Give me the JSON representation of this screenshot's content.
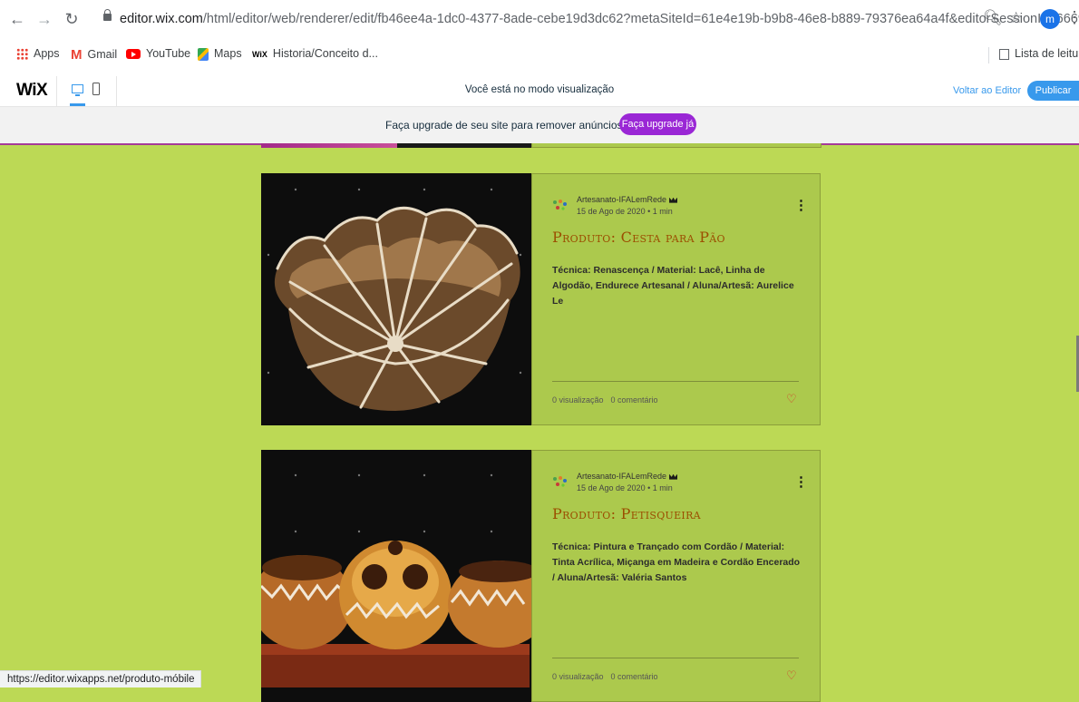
{
  "browser": {
    "url_host": "editor.wix.com",
    "url_path": "/html/editor/web/renderer/edit/fb46ee4a-1dc0-4377-8ade-cebe19d3dc62?metaSiteId=61e4e19b-b9b8-46e8-b889-79376ea64a4f&editorSessionId=666933d...",
    "profile_initial": "m",
    "bookmarks": [
      {
        "label": "Apps",
        "icon": "apps-grid-icon"
      },
      {
        "label": "Gmail",
        "icon": "gmail-icon"
      },
      {
        "label": "YouTube",
        "icon": "youtube-icon"
      },
      {
        "label": "Maps",
        "icon": "maps-icon"
      },
      {
        "label": "Historia/Conceito d...",
        "icon": "wix-icon"
      }
    ],
    "reading_list": "Lista de leitura",
    "status_url": "https://editor.wixapps.net/produto-móbile"
  },
  "wix_bar": {
    "logo": "WiX",
    "preview_message": "Você está no modo visualização",
    "back_to_editor": "Voltar ao Editor",
    "publish": "Publicar"
  },
  "upgrade_banner": {
    "text": "Faça upgrade de seu site para remover anúncios Wix",
    "button": "Faça upgrade já"
  },
  "posts": [
    {
      "author": "Artesanato-IFALemRede",
      "date": "15 de Ago de 2020",
      "read_time": "1 min",
      "title": "Produto: Cesta para Pão",
      "excerpt": "Técnica: Renascença / Material: Lacê, Linha de Algodão, Endurece Artesanal / Aluna/Artesã: Aurelice Le",
      "views": "0 visualização",
      "comments": "0 comentário"
    },
    {
      "author": "Artesanato-IFALemRede",
      "date": "15 de Ago de 2020",
      "read_time": "1 min",
      "title": "Produto: Petisqueira",
      "excerpt": "Técnica: Pintura e Trançado com Cordão / Material: Tinta Acrílica, Miçanga em Madeira e Cordão Encerado / Aluna/Artesã: Valéria Santos",
      "views": "0 visualização",
      "comments": "0 comentário"
    }
  ],
  "colors": {
    "page_background": "#bcd955",
    "card_background": "#acc94d",
    "title_color": "#9b4e00",
    "accent_blue": "#3899ec",
    "upgrade_purple": "#9a27d5",
    "heart_red": "#d23a2a"
  }
}
